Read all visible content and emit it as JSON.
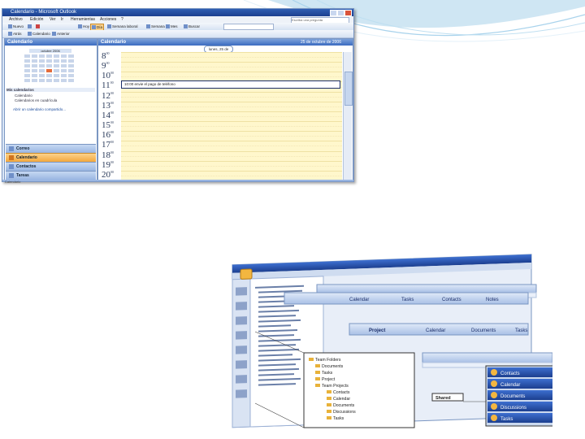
{
  "outlook": {
    "title": "Calendario - Microsoft Outlook",
    "menu": [
      "Archivo",
      "Edición",
      "Ver",
      "Ir",
      "Herramientas",
      "Acciones",
      "?"
    ],
    "toolbar1": {
      "new": "Nuevo",
      "print": "",
      "today": "Hoy",
      "day": "Día",
      "work_week": "Semana laboral",
      "week": "Semana",
      "month": "Mes",
      "search_address_book": "Buscar",
      "search_placeholder": "",
      "help_placeholder": "Escriba una pregunta"
    },
    "toolbar2": {
      "back": "Atrás",
      "reminders": "Calendario",
      "find": "Anterior"
    },
    "nav": {
      "header": "Calendario",
      "mini_calendar_month": "octubre 2006",
      "my_calendars_title": "Mis calendarios",
      "calendar_item": "Calendario",
      "open_shared": "Calendarios en cuadrícula",
      "sharing_link": "Abrir un calendario compartido...",
      "buttons": [
        {
          "label": "Correo",
          "active": false
        },
        {
          "label": "Calendario",
          "active": true
        },
        {
          "label": "Contactos",
          "active": false
        },
        {
          "label": "Tareas",
          "active": false
        }
      ]
    },
    "calendar": {
      "header": "Calendario",
      "date_range": "25 de octubre de 2006",
      "day_banner": "lunes, 25 de octubre",
      "hours": [
        "8",
        "9",
        "10",
        "11",
        "12",
        "13",
        "14",
        "15",
        "16",
        "17",
        "18",
        "19",
        "20"
      ],
      "hour_suffix": "00",
      "appointment": "10:00 envie el pago de teléfono"
    },
    "caption": "Calendario"
  },
  "project_collage": {
    "ribbon_labels": [
      "Calendar",
      "Tasks",
      "Contacts",
      "Notes",
      "Project",
      "Calendar",
      "Documents",
      "Tasks"
    ],
    "tree_items": [
      "Team Folders",
      "Documents",
      "Tasks",
      "Project",
      "Team Projects",
      "Contacts",
      "Calendar",
      "Documents",
      "Discussions",
      "Tasks"
    ],
    "shared_label": "Shared",
    "side_buttons": [
      "Contacts",
      "Calendar",
      "Documents",
      "Discussions",
      "Tasks"
    ]
  },
  "colors": {
    "outlook_titlebar": "#1c3f8f",
    "calendar_slot": "#fff7cc",
    "nav_active": "#f3a73c",
    "accent_blue": "#7ca1da"
  }
}
